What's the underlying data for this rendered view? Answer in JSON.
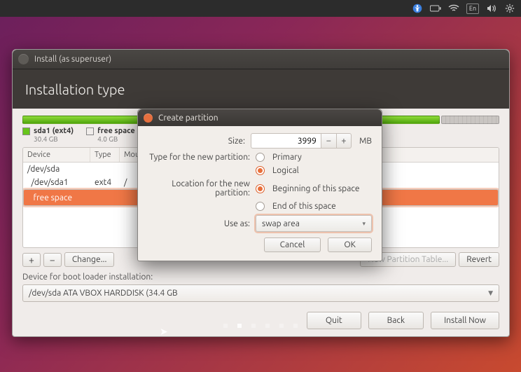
{
  "topbar": {
    "lang": "En"
  },
  "window": {
    "title": "Install (as superuser)",
    "heading": "Installation type"
  },
  "disk": {
    "segments": [
      {
        "name": "sda1 (ext4)",
        "size": "30.4 GB",
        "pct": 88,
        "kind": "used"
      },
      {
        "name": "free space",
        "size": "4.0 GB",
        "pct": 12,
        "kind": "free"
      }
    ]
  },
  "table": {
    "cols": [
      "Device",
      "Type",
      "Mount point"
    ],
    "rows": [
      {
        "device": "/dev/sda",
        "type": "",
        "mount": "",
        "selected": false
      },
      {
        "device": "  /dev/sda1",
        "type": "ext4",
        "mount": "/",
        "selected": false
      },
      {
        "device": "  free space",
        "type": "",
        "mount": "",
        "selected": true
      }
    ],
    "buttons": {
      "add": "+",
      "remove": "−",
      "change": "Change...",
      "newtable": "New Partition Table...",
      "revert": "Revert"
    }
  },
  "boot": {
    "label": "Device for boot loader installation:",
    "value": "/dev/sda   ATA VBOX HARDDISK (34.4 GB"
  },
  "footer": {
    "quit": "Quit",
    "back": "Back",
    "install": "Install Now"
  },
  "dialog": {
    "title": "Create partition",
    "size_label": "Size:",
    "size_value": "3999",
    "size_unit": "MB",
    "type_label": "Type for the new partition:",
    "type_primary": "Primary",
    "type_logical": "Logical",
    "loc_label": "Location for the new partition:",
    "loc_begin": "Beginning of this space",
    "loc_end": "End of this space",
    "use_label": "Use as:",
    "use_value": "swap area",
    "cancel": "Cancel",
    "ok": "OK"
  }
}
